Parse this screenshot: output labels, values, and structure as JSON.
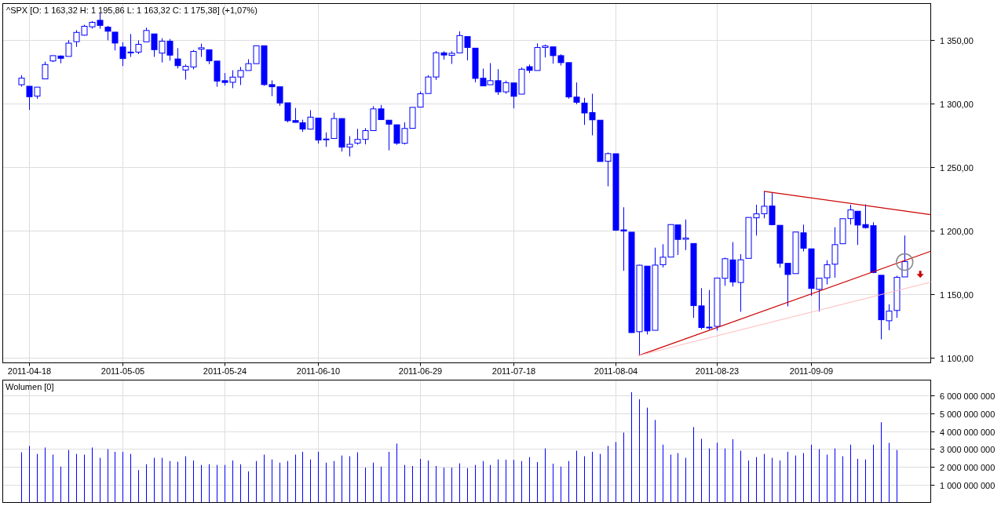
{
  "price_chart": {
    "chart_data": {
      "type": "candlestick",
      "title": "^SPX [O: 1 163,32  H: 1 195,86  L: 1 163,32  C: 1 175,38] (+1,07%)",
      "grid": true,
      "ylim": [
        1095.7,
        1378.4
      ],
      "categories": [
        null,
        "2011-04-18",
        null,
        null,
        null,
        null,
        null,
        null,
        null,
        null,
        null,
        null,
        null,
        "2011-05-05",
        null,
        null,
        null,
        null,
        null,
        null,
        null,
        null,
        null,
        null,
        null,
        null,
        "2011-05-24",
        null,
        null,
        null,
        null,
        null,
        null,
        null,
        null,
        null,
        null,
        null,
        "2011-06-10",
        null,
        null,
        null,
        null,
        null,
        null,
        null,
        null,
        null,
        null,
        null,
        null,
        "2011-06-29",
        null,
        null,
        null,
        null,
        null,
        null,
        null,
        null,
        null,
        null,
        null,
        "2011-07-18",
        null,
        null,
        null,
        null,
        null,
        null,
        null,
        null,
        null,
        null,
        null,
        null,
        "2011-08-04",
        null,
        null,
        null,
        null,
        null,
        null,
        null,
        null,
        null,
        null,
        null,
        null,
        "2011-08-23",
        null,
        null,
        null,
        null,
        null,
        null,
        null,
        null,
        null,
        null,
        null,
        "2011-09-09",
        null,
        null,
        null,
        null,
        null,
        null,
        null,
        null,
        null,
        null,
        null,
        null
      ],
      "yticks": [
        {
          "value": 1100,
          "label": "1 100,00"
        },
        {
          "value": 1150,
          "label": "1 150,00"
        },
        {
          "value": 1200,
          "label": "1 200,00"
        },
        {
          "value": 1250,
          "label": "1 250,00"
        },
        {
          "value": 1300,
          "label": "1 300,00"
        },
        {
          "value": 1350,
          "label": "1 350,00"
        }
      ],
      "ohlc": [
        [
          1314.5,
          1322,
          1313,
          1319.7
        ],
        [
          1313.3,
          1313.5,
          1294.7,
          1305.1
        ],
        [
          1305.6,
          1312.7,
          1303.5,
          1312.6
        ],
        [
          1319.1,
          1332.7,
          1319.1,
          1330.4
        ],
        [
          1333.2,
          1337.5,
          1332.3,
          1337.4
        ],
        [
          1337.1,
          1337.6,
          1331.4,
          1335.3
        ],
        [
          1336.8,
          1349.6,
          1336.8,
          1347.2
        ],
        [
          1348.4,
          1357.5,
          1344.3,
          1355.7
        ],
        [
          1353.5,
          1361.7,
          1353.2,
          1360.5
        ],
        [
          1360.1,
          1364.6,
          1358.7,
          1363.6
        ],
        [
          1365.2,
          1370.6,
          1358.6,
          1361.2
        ],
        [
          1359.8,
          1360.8,
          1349.5,
          1356.6
        ],
        [
          1355.9,
          1355.9,
          1341.5,
          1347.3
        ],
        [
          1344.2,
          1348,
          1329.2,
          1335.1
        ],
        [
          1340.2,
          1354.4,
          1336.4,
          1340.2
        ],
        [
          1340.2,
          1349.4,
          1338.6,
          1346.3
        ],
        [
          1348.3,
          1359.4,
          1348.3,
          1357.2
        ],
        [
          1354.5,
          1354.5,
          1336.4,
          1342.1
        ],
        [
          1339.4,
          1351.1,
          1332,
          1348.7
        ],
        [
          1348.7,
          1350.5,
          1333.4,
          1337.8
        ],
        [
          1334.8,
          1343.3,
          1327.3,
          1329.5
        ],
        [
          1326.1,
          1330.4,
          1318.5,
          1329
        ],
        [
          1328.5,
          1341.8,
          1326.6,
          1340.7
        ],
        [
          1342.4,
          1346.8,
          1336.4,
          1343.6
        ],
        [
          1342,
          1342,
          1330.7,
          1333.3
        ],
        [
          1333.1,
          1333.1,
          1312.9,
          1317.4
        ],
        [
          1317.7,
          1323.7,
          1313.9,
          1316.3
        ],
        [
          1316.4,
          1325.9,
          1311.8,
          1320.5
        ],
        [
          1320.6,
          1328.5,
          1314.3,
          1325.7
        ],
        [
          1325.7,
          1334.6,
          1325.7,
          1331.1
        ],
        [
          1331.1,
          1345.2,
          1331.1,
          1345.2
        ],
        [
          1345.2,
          1345.2,
          1313.7,
          1314.6
        ],
        [
          1314.6,
          1318,
          1305.6,
          1312.9
        ],
        [
          1312.9,
          1312.9,
          1297.9,
          1300.2
        ],
        [
          1300.3,
          1300.3,
          1284.9,
          1286.2
        ],
        [
          1286.3,
          1296.2,
          1284.7,
          1284.9
        ],
        [
          1284.6,
          1287,
          1277.4,
          1279.6
        ],
        [
          1279.6,
          1294.5,
          1279.6,
          1289
        ],
        [
          1288.3,
          1288.3,
          1268.2,
          1271
        ],
        [
          1271.6,
          1277,
          1265.6,
          1271.8
        ],
        [
          1272.2,
          1292.5,
          1272.2,
          1287.9
        ],
        [
          1287.9,
          1287.9,
          1261.9,
          1265.4
        ],
        [
          1265.5,
          1274.1,
          1258.1,
          1267.6
        ],
        [
          1268.6,
          1279.8,
          1267.4,
          1271.5
        ],
        [
          1271.5,
          1280.4,
          1267.6,
          1278.4
        ],
        [
          1278.4,
          1297.6,
          1278.4,
          1295.5
        ],
        [
          1295.5,
          1298.6,
          1286.8,
          1287.1
        ],
        [
          1286.6,
          1286.6,
          1262.9,
          1283.5
        ],
        [
          1283,
          1283,
          1267.2,
          1268.5
        ],
        [
          1268.4,
          1284.9,
          1267.5,
          1280.1
        ],
        [
          1280.2,
          1296.8,
          1280.2,
          1296.7
        ],
        [
          1296.9,
          1309.2,
          1296.9,
          1307.4
        ],
        [
          1307.6,
          1322,
          1307.6,
          1320.6
        ],
        [
          1320.6,
          1341,
          1318.3,
          1339.7
        ],
        [
          1339.6,
          1340.9,
          1334.3,
          1337.9
        ],
        [
          1337.6,
          1340.9,
          1330.9,
          1339.2
        ],
        [
          1339.6,
          1356.5,
          1339.6,
          1353.2
        ],
        [
          1352.4,
          1352.4,
          1333.7,
          1343.8
        ],
        [
          1343.3,
          1343.3,
          1316.4,
          1319.5
        ],
        [
          1319.6,
          1327.2,
          1313.3,
          1313.6
        ],
        [
          1314.5,
          1331.5,
          1314.5,
          1317.7
        ],
        [
          1317.7,
          1326.7,
          1306.5,
          1308.9
        ],
        [
          1308.9,
          1317.7,
          1307.4,
          1316.1
        ],
        [
          1315.9,
          1315.9,
          1295.9,
          1305.4
        ],
        [
          1307.1,
          1328.1,
          1307.1,
          1326.7
        ],
        [
          1328.7,
          1330.4,
          1323.7,
          1325.8
        ],
        [
          1325.7,
          1347,
          1325.7,
          1343.8
        ],
        [
          1343.8,
          1346.1,
          1336,
          1345
        ],
        [
          1344.3,
          1344.3,
          1331.1,
          1337.4
        ],
        [
          1337.4,
          1338.5,
          1329.6,
          1331.9
        ],
        [
          1331.9,
          1331.9,
          1303.5,
          1304.9
        ],
        [
          1304.8,
          1316.3,
          1299.2,
          1300.7
        ],
        [
          1300.1,
          1304.2,
          1282.9,
          1292.3
        ],
        [
          1292.6,
          1307.4,
          1274.7,
          1286.9
        ],
        [
          1286.6,
          1286.6,
          1254,
          1254.1
        ],
        [
          1254.3,
          1261.2,
          1234.6,
          1260.3
        ],
        [
          1260.2,
          1260.2,
          1199.5,
          1200.1
        ],
        [
          1200.3,
          1218.1,
          1168.1,
          1199.4
        ],
        [
          1198.5,
          1198.5,
          1119.3,
          1119.5
        ],
        [
          1120.2,
          1172.9,
          1101.5,
          1172.5
        ],
        [
          1171.8,
          1171.8,
          1118,
          1120.8
        ],
        [
          1121.3,
          1186.3,
          1121.3,
          1172.6
        ],
        [
          1172.9,
          1189,
          1170.7,
          1178.8
        ],
        [
          1178.9,
          1204.5,
          1178.9,
          1204.5
        ],
        [
          1204.2,
          1204.2,
          1180.5,
          1192.8
        ],
        [
          1192.9,
          1208.5,
          1184.4,
          1193.9
        ],
        [
          1189.6,
          1189.6,
          1131.1,
          1140.7
        ],
        [
          1140.5,
          1154.5,
          1122,
          1123.5
        ],
        [
          1123.6,
          1153,
          1121.6,
          1123.8
        ],
        [
          1124.4,
          1162.4,
          1121.1,
          1162.4
        ],
        [
          1162.2,
          1178.5,
          1156.3,
          1177.6
        ],
        [
          1176.7,
          1190.7,
          1155.7,
          1159.3
        ],
        [
          1158.9,
          1181.2,
          1135.9,
          1176.8
        ],
        [
          1177.9,
          1210.1,
          1177.9,
          1210.1
        ],
        [
          1209.8,
          1220.1,
          1195.8,
          1212.9
        ],
        [
          1213,
          1230.7,
          1209.4,
          1218.9
        ],
        [
          1219.1,
          1229.3,
          1203.9,
          1204.4
        ],
        [
          1203.9,
          1203.9,
          1170.6,
          1174
        ],
        [
          1174,
          1174,
          1140.1,
          1165.2
        ],
        [
          1165.9,
          1198.6,
          1165.9,
          1198.6
        ],
        [
          1198,
          1204.4,
          1183.3,
          1185.9
        ],
        [
          1185.4,
          1185.4,
          1148.4,
          1154.2
        ],
        [
          1153.5,
          1162.5,
          1136.1,
          1162.3
        ],
        [
          1162.6,
          1176.4,
          1157.4,
          1172.9
        ],
        [
          1173.3,
          1202.4,
          1162.7,
          1188.7
        ],
        [
          1189.4,
          1209.1,
          1189.4,
          1209.1
        ],
        [
          1209.2,
          1220.1,
          1204.5,
          1216
        ],
        [
          1215,
          1215,
          1188.4,
          1204.1
        ],
        [
          1204.5,
          1220.4,
          1201.3,
          1202.1
        ],
        [
          1203.6,
          1206.3,
          1166.2,
          1166.8
        ],
        [
          1164.6,
          1164.6,
          1114.2,
          1129.6
        ],
        [
          1128.8,
          1141.7,
          1121.4,
          1136.4
        ],
        [
          1136.9,
          1164.2,
          1131.1,
          1163
        ],
        [
          1163.3,
          1195.9,
          1163.3,
          1175.4
        ]
      ]
    }
  },
  "volume_chart": {
    "chart_data": {
      "type": "bar",
      "title": "Wolumen [0]",
      "grid": true,
      "ylim": [
        0,
        6880000000
      ],
      "yticks": [
        {
          "value": 1000000000,
          "label": "1 000 000 000"
        },
        {
          "value": 2000000000,
          "label": "2 000 000 000"
        },
        {
          "value": 3000000000,
          "label": "3 000 000 000"
        },
        {
          "value": 4000000000,
          "label": "4 000 000 000"
        },
        {
          "value": 5000000000,
          "label": "5 000 000 000"
        },
        {
          "value": 6000000000,
          "label": "6 000 000 000"
        }
      ],
      "values": [
        2820000000.0,
        3180000000.0,
        2730000000.0,
        3090000000.0,
        2690000000.0,
        2020000000.0,
        2950000000.0,
        2730000000.0,
        2690000000.0,
        3090000000.0,
        2510000000.0,
        3000000000.0,
        2850000000.0,
        2850000000.0,
        2730000000.0,
        1820000000.0,
        2150000000.0,
        2510000000.0,
        2510000000.0,
        2330000000.0,
        2290000000.0,
        2600000000.0,
        2360000000.0,
        2110000000.0,
        2150000000.0,
        2110000000.0,
        2110000000.0,
        2360000000.0,
        2150000000.0,
        1750000000.0,
        2330000000.0,
        2690000000.0,
        2420000000.0,
        2240000000.0,
        2330000000.0,
        2690000000.0,
        2850000000.0,
        2420000000.0,
        2850000000.0,
        2240000000.0,
        2330000000.0,
        2640000000.0,
        2600000000.0,
        2820000000.0,
        1960000000.0,
        2240000000.0,
        2020000000.0,
        2850000000.0,
        3310000000.0,
        2110000000.0,
        2050000000.0,
        2450000000.0,
        2360000000.0,
        2050000000.0,
        1960000000.0,
        1960000000.0,
        2200000000.0,
        1930000000.0,
        2110000000.0,
        2330000000.0,
        2110000000.0,
        2420000000.0,
        2400000000.0,
        2400000000.0,
        2330000000.0,
        2550000000.0,
        2270000000.0,
        3040000000.0,
        2180000000.0,
        2020000000.0,
        2330000000.0,
        2910000000.0,
        2600000000.0,
        2850000000.0,
        2730000000.0,
        3180000000.0,
        3400000000.0,
        3930000000.0,
        6200000000.0,
        5800000000.0,
        5330000000.0,
        4640000000.0,
        3250000000.0,
        2690000000.0,
        2780000000.0,
        2510000000.0,
        4240000000.0,
        3580000000.0,
        3040000000.0,
        3360000000.0,
        3040000000.0,
        3560000000.0,
        2910000000.0,
        2360000000.0,
        2550000000.0,
        2730000000.0,
        2510000000.0,
        2360000000.0,
        2850000000.0,
        2640000000.0,
        2780000000.0,
        3250000000.0,
        3000000000.0,
        2690000000.0,
        3040000000.0,
        2600000000.0,
        3250000000.0,
        2450000000.0,
        2420000000.0,
        3250000000.0,
        4510000000.0,
        3350000000.0,
        2950000000.0,
        null
      ]
    }
  }
}
